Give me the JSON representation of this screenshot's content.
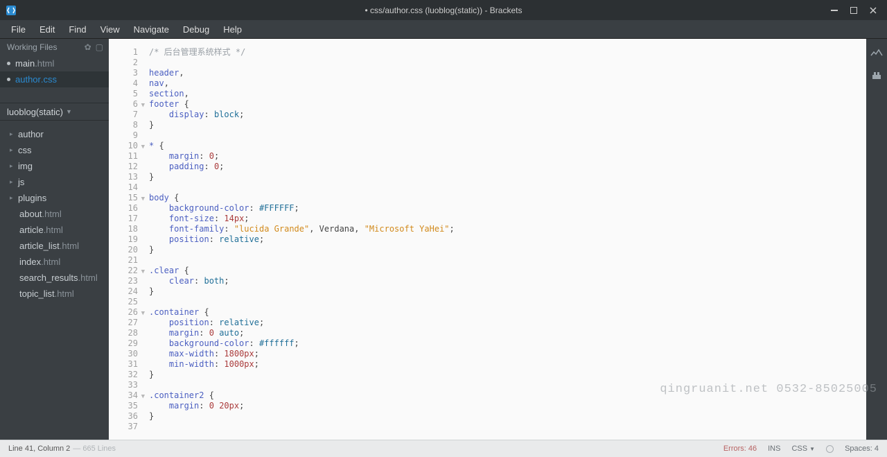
{
  "window": {
    "title": "• css/author.css (luoblog(static)) - Brackets"
  },
  "menu": [
    "File",
    "Edit",
    "Find",
    "View",
    "Navigate",
    "Debug",
    "Help"
  ],
  "sidebar": {
    "working_files_label": "Working Files",
    "working_files": [
      {
        "name": "main",
        "ext": ".html",
        "modified": true,
        "active": false
      },
      {
        "name": "author",
        "ext": ".css",
        "modified": true,
        "active": true
      }
    ],
    "project_name": "luoblog(static)",
    "tree": [
      {
        "type": "dir",
        "name": "author"
      },
      {
        "type": "dir",
        "name": "css"
      },
      {
        "type": "dir",
        "name": "img"
      },
      {
        "type": "dir",
        "name": "js"
      },
      {
        "type": "dir",
        "name": "plugins"
      },
      {
        "type": "file",
        "name": "about",
        "ext": ".html"
      },
      {
        "type": "file",
        "name": "article",
        "ext": ".html"
      },
      {
        "type": "file",
        "name": "article_list",
        "ext": ".html"
      },
      {
        "type": "file",
        "name": "index",
        "ext": ".html"
      },
      {
        "type": "file",
        "name": "search_results",
        "ext": ".html"
      },
      {
        "type": "file",
        "name": "topic_list",
        "ext": ".html"
      }
    ]
  },
  "editor": {
    "fold_lines": [
      6,
      10,
      15,
      22,
      26,
      34
    ],
    "lines": [
      [
        [
          "com",
          "/* 后台管理系统样式 */"
        ]
      ],
      [],
      [
        [
          "tag",
          "header"
        ],
        [
          "punc",
          ","
        ]
      ],
      [
        [
          "tag",
          "nav"
        ],
        [
          "punc",
          ","
        ]
      ],
      [
        [
          "tag",
          "section"
        ],
        [
          "punc",
          ","
        ]
      ],
      [
        [
          "tag",
          "footer"
        ],
        [
          "punc",
          " {"
        ]
      ],
      [
        [
          "txt",
          "    "
        ],
        [
          "prop",
          "display"
        ],
        [
          "punc",
          ": "
        ],
        [
          "kw",
          "block"
        ],
        [
          "punc",
          ";"
        ]
      ],
      [
        [
          "punc",
          "}"
        ]
      ],
      [],
      [
        [
          "tag",
          "*"
        ],
        [
          "punc",
          " {"
        ]
      ],
      [
        [
          "txt",
          "    "
        ],
        [
          "prop",
          "margin"
        ],
        [
          "punc",
          ": "
        ],
        [
          "num",
          "0"
        ],
        [
          "punc",
          ";"
        ]
      ],
      [
        [
          "txt",
          "    "
        ],
        [
          "prop",
          "padding"
        ],
        [
          "punc",
          ": "
        ],
        [
          "num",
          "0"
        ],
        [
          "punc",
          ";"
        ]
      ],
      [
        [
          "punc",
          "}"
        ]
      ],
      [],
      [
        [
          "tag",
          "body"
        ],
        [
          "punc",
          " {"
        ]
      ],
      [
        [
          "txt",
          "    "
        ],
        [
          "prop",
          "background-color"
        ],
        [
          "punc",
          ": "
        ],
        [
          "kw",
          "#FFFFFF"
        ],
        [
          "punc",
          ";"
        ]
      ],
      [
        [
          "txt",
          "    "
        ],
        [
          "prop",
          "font-size"
        ],
        [
          "punc",
          ": "
        ],
        [
          "num",
          "14px"
        ],
        [
          "punc",
          ";"
        ]
      ],
      [
        [
          "txt",
          "    "
        ],
        [
          "prop",
          "font-family"
        ],
        [
          "punc",
          ": "
        ],
        [
          "str",
          "\"lucida Grande\""
        ],
        [
          "punc",
          ", Verdana, "
        ],
        [
          "str",
          "\"Microsoft YaHei\""
        ],
        [
          "punc",
          ";"
        ]
      ],
      [
        [
          "txt",
          "    "
        ],
        [
          "prop",
          "position"
        ],
        [
          "punc",
          ": "
        ],
        [
          "kw",
          "relative"
        ],
        [
          "punc",
          ";"
        ]
      ],
      [
        [
          "punc",
          "}"
        ]
      ],
      [],
      [
        [
          "tag",
          ".clear"
        ],
        [
          "punc",
          " {"
        ]
      ],
      [
        [
          "txt",
          "    "
        ],
        [
          "prop",
          "clear"
        ],
        [
          "punc",
          ": "
        ],
        [
          "kw",
          "both"
        ],
        [
          "punc",
          ";"
        ]
      ],
      [
        [
          "punc",
          "}"
        ]
      ],
      [],
      [
        [
          "tag",
          ".container"
        ],
        [
          "punc",
          " {"
        ]
      ],
      [
        [
          "txt",
          "    "
        ],
        [
          "prop",
          "position"
        ],
        [
          "punc",
          ": "
        ],
        [
          "kw",
          "relative"
        ],
        [
          "punc",
          ";"
        ]
      ],
      [
        [
          "txt",
          "    "
        ],
        [
          "prop",
          "margin"
        ],
        [
          "punc",
          ": "
        ],
        [
          "num",
          "0"
        ],
        [
          "punc",
          " "
        ],
        [
          "kw",
          "auto"
        ],
        [
          "punc",
          ";"
        ]
      ],
      [
        [
          "txt",
          "    "
        ],
        [
          "prop",
          "background-color"
        ],
        [
          "punc",
          ": "
        ],
        [
          "kw",
          "#ffffff"
        ],
        [
          "punc",
          ";"
        ]
      ],
      [
        [
          "txt",
          "    "
        ],
        [
          "prop",
          "max-width"
        ],
        [
          "punc",
          ": "
        ],
        [
          "num",
          "1800px"
        ],
        [
          "punc",
          ";"
        ]
      ],
      [
        [
          "txt",
          "    "
        ],
        [
          "prop",
          "min-width"
        ],
        [
          "punc",
          ": "
        ],
        [
          "num",
          "1000px"
        ],
        [
          "punc",
          ";"
        ]
      ],
      [
        [
          "punc",
          "}"
        ]
      ],
      [],
      [
        [
          "tag",
          ".container2"
        ],
        [
          "punc",
          " {"
        ]
      ],
      [
        [
          "txt",
          "    "
        ],
        [
          "prop",
          "margin"
        ],
        [
          "punc",
          ": "
        ],
        [
          "num",
          "0"
        ],
        [
          "punc",
          " "
        ],
        [
          "num",
          "20px"
        ],
        [
          "punc",
          ";"
        ]
      ],
      [
        [
          "punc",
          "}"
        ]
      ],
      []
    ]
  },
  "status": {
    "cursor": "Line 41, Column 2",
    "total_lines": " — 665 Lines",
    "errors_label": "Errors: 46",
    "ins": "INS",
    "lang": "CSS",
    "spaces": "Spaces: 4"
  },
  "watermark": "qingruanit.net 0532-85025005"
}
